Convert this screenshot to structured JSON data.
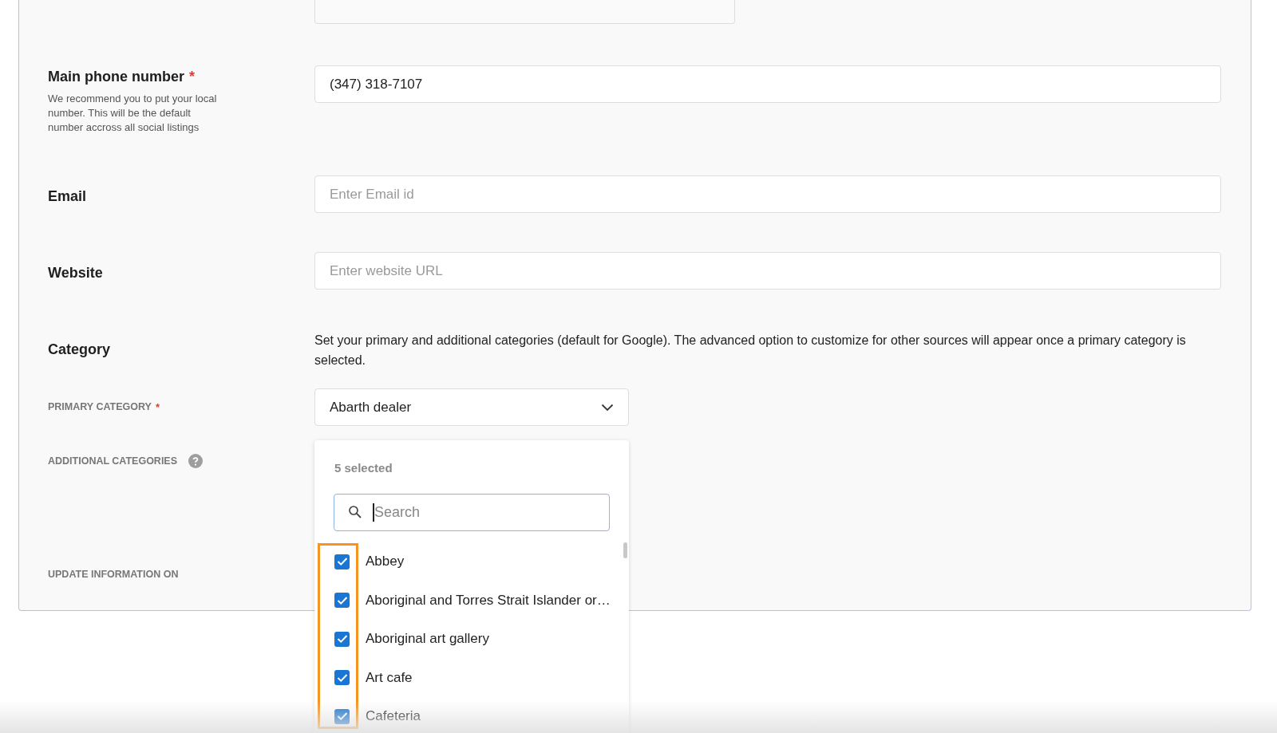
{
  "required_mark": "*",
  "fields": [
    {
      "label": "Main phone number",
      "required": true,
      "hint": "We recommend you to put your local number. This will be the default number accross all social listings",
      "value": "(347) 318-7107"
    },
    {
      "label": "Email",
      "required": false,
      "placeholder": "Enter Email id"
    },
    {
      "label": "Website",
      "required": false,
      "placeholder": "Enter website URL"
    }
  ],
  "category": {
    "label": "Category",
    "description": "Set your primary and additional categories (default for Google). The advanced option to customize for other sources will appear once a primary category is selected.",
    "primary": {
      "label": "PRIMARY CATEGORY",
      "required": true,
      "value": "Abarth dealer"
    },
    "additional": {
      "label": "ADDITIONAL CATEGORIES",
      "dropdown": {
        "count": "5 selected",
        "search_placeholder": "Search",
        "options": [
          {
            "label": "Abbey",
            "checked": true
          },
          {
            "label": "Aboriginal and Torres Strait Islander or…",
            "checked": true
          },
          {
            "label": "Aboriginal art gallery",
            "checked": true
          },
          {
            "label": "Art cafe",
            "checked": true
          },
          {
            "label": "Cafeteria",
            "checked": true
          }
        ]
      }
    }
  },
  "update_label": "UPDATE INFORMATION ON"
}
